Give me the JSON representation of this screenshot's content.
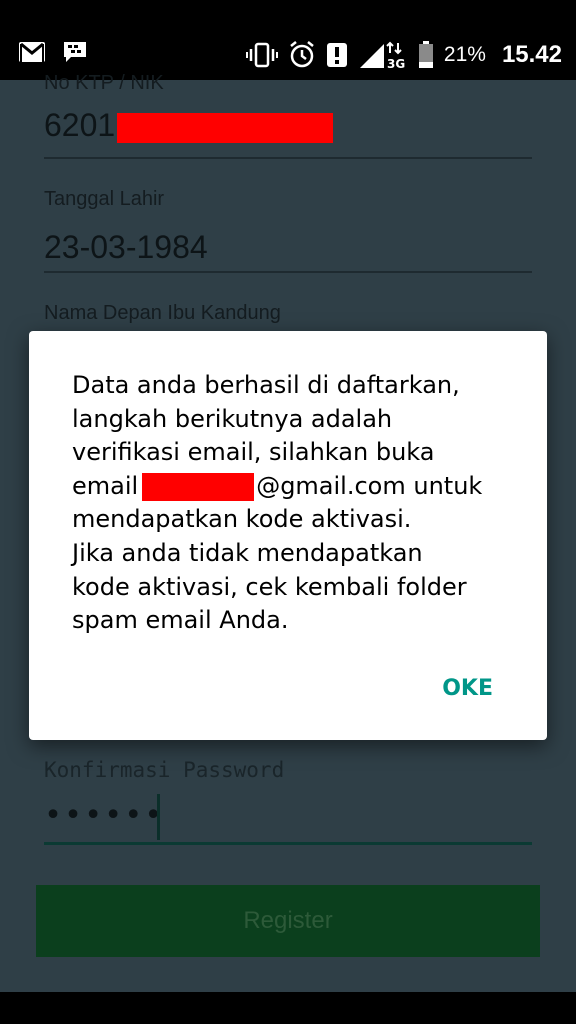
{
  "status_bar": {
    "battery_percent": "21%",
    "time": "15.42",
    "network_type": "3G"
  },
  "form": {
    "ktp": {
      "label": "No KTP / NIK",
      "value_prefix": "6201"
    },
    "birthdate": {
      "label": "Tanggal Lahir",
      "value": "23-03-1984"
    },
    "mother_name": {
      "label": "Nama Depan Ibu Kandung"
    },
    "confirm_password": {
      "label": "Konfirmasi Password",
      "value": "••••••"
    },
    "register_label": "Register"
  },
  "dialog": {
    "lines": [
      "Data anda berhasil di daftarkan,",
      "langkah berikutnya adalah",
      "verifikasi email, silahkan buka",
      "email",
      "@gmail.com untuk",
      "mendapatkan kode aktivasi.",
      "Jika anda tidak mendapatkan",
      "kode aktivasi, cek kembali folder",
      "spam email Anda."
    ],
    "ok_label": "OKE"
  },
  "colors": {
    "app_background": "#2f3f47",
    "accent": "#009688",
    "redaction": "#ff0000",
    "register_button": "#0b3f1d"
  }
}
